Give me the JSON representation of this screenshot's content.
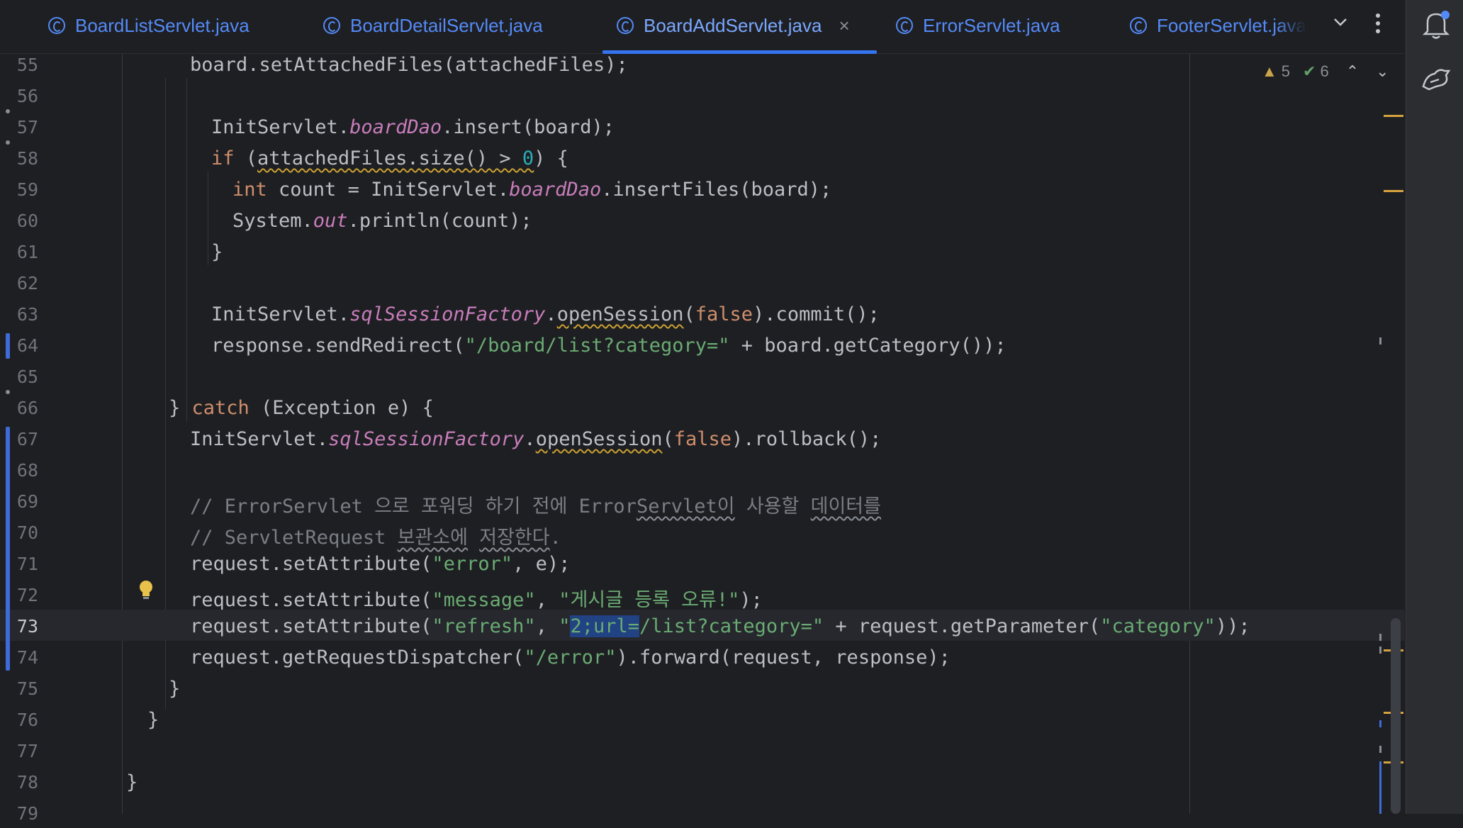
{
  "tabs": [
    {
      "label": "BoardListServlet.java",
      "active": false
    },
    {
      "label": "BoardDetailServlet.java",
      "active": false
    },
    {
      "label": "BoardAddServlet.java",
      "active": true
    },
    {
      "label": "ErrorServlet.java",
      "active": false
    },
    {
      "label": "FooterServlet.java",
      "active": false
    }
  ],
  "close_glyph": "×",
  "inspections": {
    "warnings": "5",
    "weak_warnings": "6"
  },
  "line_numbers": [
    "55",
    "56",
    "57",
    "58",
    "59",
    "60",
    "61",
    "62",
    "63",
    "64",
    "65",
    "66",
    "67",
    "68",
    "69",
    "70",
    "71",
    "72",
    "73",
    "74",
    "75",
    "76",
    "77",
    "78",
    "79"
  ],
  "code": {
    "l55": {
      "a": "board.setAttachedFiles(attachedFiles);"
    },
    "l57": {
      "a": "InitServlet.",
      "b": "boardDao",
      "c": ".insert(board);"
    },
    "l58": {
      "kw": "if",
      "sp": " (",
      "a": "attachedFiles.size() > ",
      "num": "0",
      "b": ") {"
    },
    "l59": {
      "kw": "int",
      "a": " count = InitServlet.",
      "b": "boardDao",
      "c": ".insertFiles(board);"
    },
    "l60": {
      "a": "System.",
      "b": "out",
      "c": ".println(count);"
    },
    "l61": {
      "a": "}"
    },
    "l63": {
      "a": "InitServlet.",
      "b": "sqlSessionFactory",
      "c": ".",
      "d": "openSession",
      "e": "(",
      "kw": "false",
      "f": ").commit();"
    },
    "l64": {
      "a": "response.sendRedirect(",
      "s": "\"/board/list?category=\"",
      "b": " + board.getCategory());"
    },
    "l66": {
      "a": "} ",
      "kw": "catch",
      "b": " (Exception e) {"
    },
    "l67": {
      "a": "InitServlet.",
      "b": "sqlSessionFactory",
      "c": ".",
      "d": "openSession",
      "e": "(",
      "kw": "false",
      "f": ").rollback();"
    },
    "l69": {
      "a": "// ErrorServlet 으로 포워딩 하기 전에 Error",
      "b": "Servlet이",
      "c": " 사용할 ",
      "d": "데이터를"
    },
    "l70": {
      "a": "// ServletRequest ",
      "b": "보관소에",
      "c": " ",
      "d": "저장한다",
      "e": "."
    },
    "l71": {
      "a": "request.setAttribute(",
      "s": "\"error\"",
      "b": ", e);"
    },
    "l72": {
      "a": "request.setAttribute(",
      "s1": "\"message\"",
      "b": ", ",
      "s2": "\"게시글 등록 오류!\"",
      "c": ");"
    },
    "l73": {
      "a": "request.setAttribute(",
      "s1": "\"refresh\"",
      "b": ", ",
      "q": "\"",
      "sel": "2;url=",
      "s2": "/list?category=\"",
      "c": " + request.getParameter(",
      "s3": "\"category\"",
      "d": "));"
    },
    "l74": {
      "a": "request.getRequestDispatcher(",
      "s": "\"/error\"",
      "b": ").forward(request, response);"
    },
    "l75": {
      "a": "}"
    },
    "l76": {
      "a": "}"
    },
    "l78": {
      "a": "}"
    }
  },
  "colors": {
    "accent": "#3574f0",
    "keyword": "#cf8e6d",
    "string": "#6aab73",
    "field": "#c77dbb",
    "number": "#2aacb8",
    "comment": "#7a7e85",
    "warning": "#d6a23e"
  },
  "icons": {
    "tab_file": "class-c-icon",
    "bulb": "lightbulb-icon",
    "bell": "notification-bell-icon",
    "assistant": "ai-assistant-icon"
  }
}
